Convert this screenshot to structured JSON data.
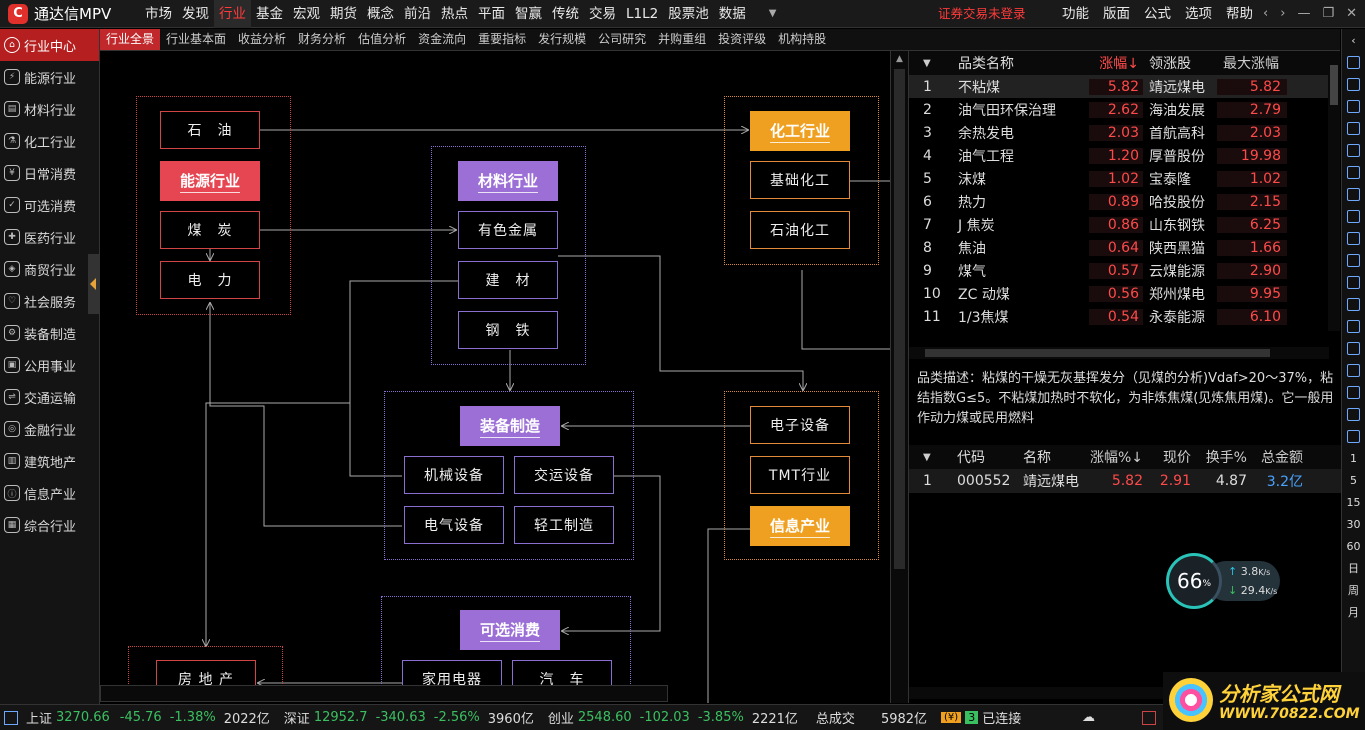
{
  "app": {
    "logo_glyph": "C",
    "title": "通达信MPV"
  },
  "menu": {
    "items": [
      "市场",
      "发现",
      "行业",
      "基金",
      "宏观",
      "期货",
      "概念",
      "前沿",
      "热点",
      "平面",
      "智赢",
      "传统",
      "交易",
      "L1L2",
      "股票池",
      "数据"
    ],
    "active_index": 2,
    "login_warning": "证券交易未登录",
    "right_items": [
      "功能",
      "版面",
      "公式",
      "选项",
      "帮助"
    ],
    "window_controls": [
      "‹",
      "›",
      "—",
      "❐",
      "✕"
    ]
  },
  "sidebar": {
    "items": [
      {
        "label": "行业中心",
        "icon": "house-icon",
        "active": true
      },
      {
        "label": "能源行业",
        "icon": "energy-icon"
      },
      {
        "label": "材料行业",
        "icon": "materials-icon"
      },
      {
        "label": "化工行业",
        "icon": "chemical-icon"
      },
      {
        "label": "日常消费",
        "icon": "yen-icon"
      },
      {
        "label": "可选消费",
        "icon": "check-circle-icon"
      },
      {
        "label": "医药行业",
        "icon": "medicine-icon"
      },
      {
        "label": "商贸行业",
        "icon": "trade-icon"
      },
      {
        "label": "社会服务",
        "icon": "heart-icon"
      },
      {
        "label": "装备制造",
        "icon": "gear-icon"
      },
      {
        "label": "公用事业",
        "icon": "utility-icon"
      },
      {
        "label": "交通运输",
        "icon": "transport-icon"
      },
      {
        "label": "金融行业",
        "icon": "finance-icon"
      },
      {
        "label": "建筑地产",
        "icon": "building-icon"
      },
      {
        "label": "信息产业",
        "icon": "info-icon"
      },
      {
        "label": "综合行业",
        "icon": "grid-icon"
      }
    ]
  },
  "subtabs": {
    "items": [
      "行业全景",
      "行业基本面",
      "收益分析",
      "财务分析",
      "估值分析",
      "资金流向",
      "重要指标",
      "发行规模",
      "公司研究",
      "并购重组",
      "投资评级",
      "机构持股"
    ],
    "active_index": 0
  },
  "diagram": {
    "energy": {
      "header": "能源行业",
      "nodes": [
        "石　油",
        "煤　炭",
        "电　力"
      ]
    },
    "materials": {
      "header": "材料行业",
      "nodes": [
        "有色金属",
        "建　材",
        "钢　铁"
      ]
    },
    "chemical": {
      "header": "化工行业",
      "nodes": [
        "基础化工",
        "石油化工"
      ]
    },
    "equipment": {
      "header": "装备制造",
      "nodes": [
        "机械设备",
        "交运设备",
        "电气设备",
        "轻工制造"
      ]
    },
    "info": {
      "header": "信息产业",
      "nodes": [
        "电子设备",
        "TMT行业"
      ]
    },
    "consumer": {
      "header": "可选消费",
      "nodes": [
        "家用电器",
        "汽　车"
      ]
    },
    "realestate": {
      "nodes": [
        "房 地 产"
      ]
    }
  },
  "table1": {
    "headers": {
      "name": "品类名称",
      "pct": "涨幅↓",
      "lead": "领涨股",
      "max": "最大涨幅"
    },
    "rows": [
      {
        "idx": "1",
        "name": "不粘煤",
        "pct": "5.82",
        "lead": "靖远煤电",
        "max": "5.82"
      },
      {
        "idx": "2",
        "name": "油气田环保治理",
        "pct": "2.62",
        "lead": "海油发展",
        "max": "2.79"
      },
      {
        "idx": "3",
        "name": "余热发电",
        "pct": "2.03",
        "lead": "首航高科",
        "max": "2.03"
      },
      {
        "idx": "4",
        "name": "油气工程",
        "pct": "1.20",
        "lead": "厚普股份",
        "max": "19.98"
      },
      {
        "idx": "5",
        "name": "沫煤",
        "pct": "1.02",
        "lead": "宝泰隆",
        "max": "1.02"
      },
      {
        "idx": "6",
        "name": "热力",
        "pct": "0.89",
        "lead": "哈投股份",
        "max": "2.15"
      },
      {
        "idx": "7",
        "name": "J 焦炭",
        "pct": "0.86",
        "lead": "山东钢铁",
        "max": "6.25"
      },
      {
        "idx": "8",
        "name": "焦油",
        "pct": "0.64",
        "lead": "陕西黑猫",
        "max": "1.66"
      },
      {
        "idx": "9",
        "name": "煤气",
        "pct": "0.57",
        "lead": "云煤能源",
        "max": "2.90"
      },
      {
        "idx": "10",
        "name": "ZC 动煤",
        "pct": "0.56",
        "lead": "郑州煤电",
        "max": "9.95"
      },
      {
        "idx": "11",
        "name": "1/3焦煤",
        "pct": "0.54",
        "lead": "永泰能源",
        "max": "6.10"
      }
    ]
  },
  "description": "品类描述：粘煤的干燥无灰基挥发分（见煤的分析)Vdaf>20～37%，粘结指数G≤5。不粘煤加热时不软化，为非炼焦煤(见炼焦用煤)。它一般用作动力煤或民用燃料",
  "table2": {
    "headers": {
      "code": "代码",
      "name": "名称",
      "pct": "涨幅%↓",
      "price": "现价",
      "turnover": "换手%",
      "amount": "总金额"
    },
    "rows": [
      {
        "idx": "1",
        "code": "000552",
        "name": "靖远煤电",
        "pct": "5.82",
        "price": "2.91",
        "turnover": "4.87",
        "amount": "3.2亿"
      }
    ]
  },
  "gauge": {
    "percent": "66",
    "unit": "%",
    "up": "3.8",
    "down": "29.4",
    "rate_unit": "K/s"
  },
  "right_toolbar": [
    "1",
    "5",
    "15",
    "30",
    "60",
    "日",
    "周",
    "月"
  ],
  "status": {
    "sh": {
      "name": "上证",
      "value": "3270.66",
      "chg": "-45.76",
      "pct": "-1.38%",
      "vol": "2022亿"
    },
    "sz": {
      "name": "深证",
      "value": "12952.7",
      "chg": "-340.63",
      "pct": "-2.56%",
      "vol": "3960亿"
    },
    "cy": {
      "name": "创业",
      "value": "2548.60",
      "chg": "-102.03",
      "pct": "-3.85%",
      "vol": "2221亿"
    },
    "total_label": "总成交",
    "total_value": "5982亿",
    "badge1": "(¥)",
    "badge2": "3",
    "connected": "已连接"
  },
  "watermark": {
    "line1": "分析家公式网",
    "line2": "WWW.70822.COM"
  }
}
